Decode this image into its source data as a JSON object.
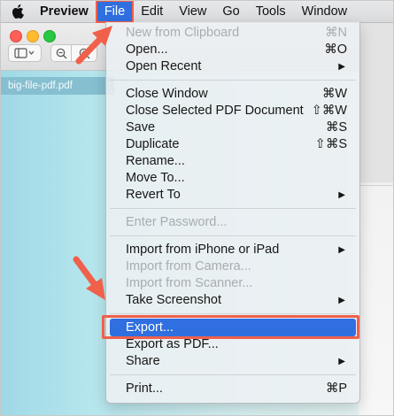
{
  "menubar": {
    "app_name": "Preview",
    "items": [
      "File",
      "Edit",
      "View",
      "Go",
      "Tools",
      "Window"
    ]
  },
  "window": {
    "filename": "big-file-pdf.pdf"
  },
  "file_menu": {
    "items": [
      {
        "label": "New from Clipboard",
        "shortcut": "⌘N",
        "disabled": true
      },
      {
        "label": "Open...",
        "shortcut": "⌘O"
      },
      {
        "label": "Open Recent",
        "arrow": "▶"
      },
      {
        "label": "Close Window",
        "shortcut": "⌘W"
      },
      {
        "label": "Close Selected PDF Document",
        "shortcut": "⇧⌘W"
      },
      {
        "label": "Save",
        "shortcut": "⌘S"
      },
      {
        "label": "Duplicate",
        "shortcut": "⇧⌘S"
      },
      {
        "label": "Rename..."
      },
      {
        "label": "Move To..."
      },
      {
        "label": "Revert To",
        "arrow": "▶"
      },
      {
        "label": "Enter Password...",
        "disabled": true
      },
      {
        "label": "Import from iPhone or iPad",
        "arrow": "▶"
      },
      {
        "label": "Import from Camera...",
        "disabled": true
      },
      {
        "label": "Import from Scanner...",
        "disabled": true
      },
      {
        "label": "Take Screenshot",
        "arrow": "▶"
      },
      {
        "label": "Export...",
        "highlighted": true
      },
      {
        "label": "Export as PDF..."
      },
      {
        "label": "Share",
        "arrow": "▶"
      },
      {
        "label": "Print...",
        "shortcut": "⌘P"
      }
    ]
  },
  "colors": {
    "highlight": "#2f6fe0",
    "callout_red": "#f0604a"
  },
  "icons": [
    "apple-icon",
    "sidebar-icon",
    "zoom-out-icon",
    "zoom-in-icon",
    "callout-arrow-icon"
  ]
}
